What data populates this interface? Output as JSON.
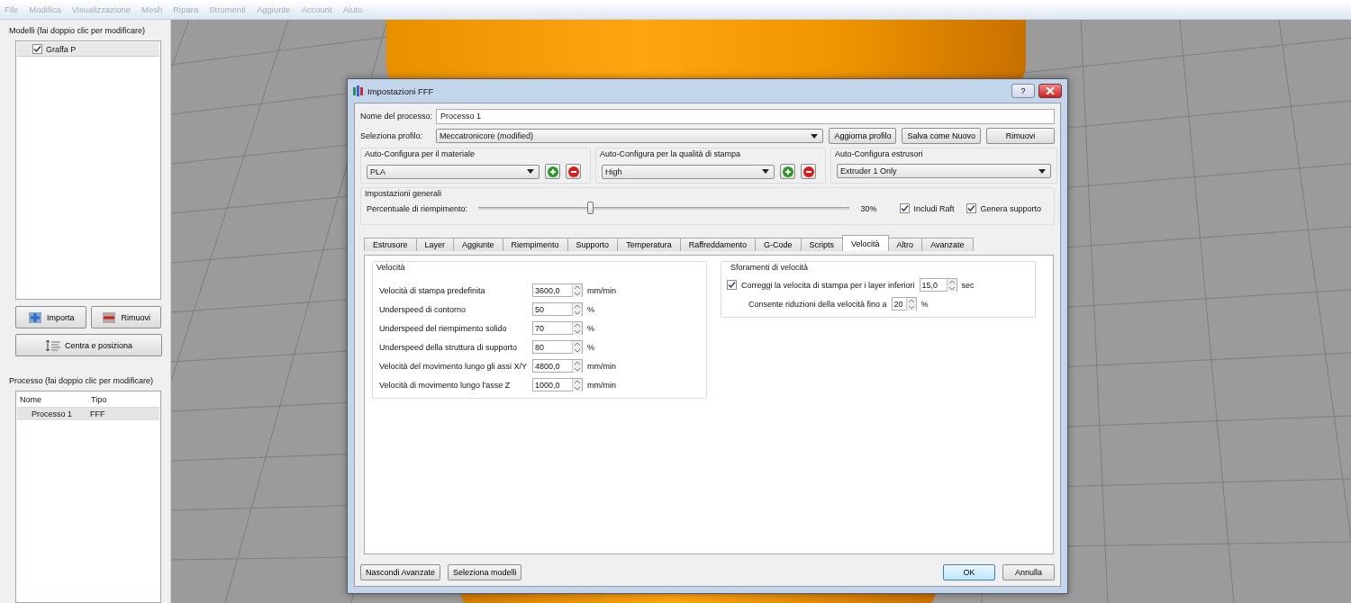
{
  "menu": [
    "File",
    "Modifica",
    "Visualizzazione",
    "Mesh",
    "Ripara",
    "Strumenti",
    "Aggiunte",
    "Account",
    "Aiuto"
  ],
  "models_panel": {
    "title": "Modelli (fai doppio clic per modificare)",
    "items": [
      {
        "label": "Graffa P",
        "checked": true
      }
    ],
    "import_button": "Importa",
    "remove_button": "Rimuovi",
    "center_button": "Centra e posiziona"
  },
  "process_panel": {
    "title": "Processo (fai doppio clic per modificare)",
    "columns": [
      "Nome",
      "Tipo"
    ],
    "rows": [
      {
        "cells": [
          "Processo 1",
          "FFF"
        ],
        "selected": true
      }
    ]
  },
  "dialog": {
    "title": "Impostazioni FFF",
    "help_button": "?",
    "process_name_label": "Nome del processo:",
    "process_name": "Processo 1",
    "profile_label": "Seleziona profilo:",
    "profile": "Meccatronicore (modified)",
    "profile_buttons": [
      "Aggiorna profilo",
      "Salva come Nuovo",
      "Rimuovi"
    ],
    "material": {
      "title": "Auto-Configura per il materiale",
      "value": "PLA"
    },
    "quality": {
      "title": "Auto-Configura per la qualità di stampa",
      "value": "High"
    },
    "extruders": {
      "title": "Auto-Configura estrusori",
      "value": "Extruder 1 Only"
    },
    "general": {
      "title": "Impostazioni generali",
      "infill_label": "Percentuale di riempimento:",
      "level": 0.3,
      "reading": "30%",
      "checks": [
        {
          "label": "Includi Raft",
          "checked": true
        },
        {
          "label": "Genera supporto",
          "checked": true
        }
      ]
    },
    "tabs": [
      {
        "label": "Estrusore",
        "selected": false
      },
      {
        "label": "Layer",
        "selected": false
      },
      {
        "label": "Aggiunte",
        "selected": false
      },
      {
        "label": "Riempimento",
        "selected": false
      },
      {
        "label": "Supporto",
        "selected": false
      },
      {
        "label": "Temperatura",
        "selected": false
      },
      {
        "label": "Raffreddamento",
        "selected": false
      },
      {
        "label": "G-Code",
        "selected": false
      },
      {
        "label": "Scripts",
        "selected": false
      },
      {
        "label": "Velocità",
        "selected": true
      },
      {
        "label": "Altro",
        "selected": false
      },
      {
        "label": "Avanzate",
        "selected": false
      }
    ],
    "speed": {
      "title": "Velocità",
      "rows": [
        {
          "label": "Velocità di stampa predefinita",
          "value": "3600,0",
          "unit": "mm/min"
        },
        {
          "label": "Underspeed di contorno",
          "value": "50",
          "unit": "%"
        },
        {
          "label": "Underspeed del riempimento solido",
          "value": "70",
          "unit": "%"
        },
        {
          "label": "Underspeed della struttura di supporto",
          "value": "80",
          "unit": "%"
        },
        {
          "label": "Velocità del movimento lungo gli assi X/Y",
          "value": "4800,0",
          "unit": "mm/min"
        },
        {
          "label": "Velocità di movimento lungo l'asse Z",
          "value": "1000,0",
          "unit": "mm/min"
        }
      ]
    },
    "overrides": {
      "title": "Sforamenti di velocità",
      "check": {
        "label": "Correggi la velocita di stampa per i layer inferiori",
        "checked": true,
        "value": "15,0",
        "unit": "sec"
      },
      "limit": {
        "label": "Consente riduzioni della velocità fino a",
        "value": "20",
        "unit": "%"
      }
    },
    "footer_left": [
      "Nascondi Avanzate",
      "Seleziona modelli"
    ],
    "ok_button": "OK",
    "cancel_button": "Annulla"
  }
}
